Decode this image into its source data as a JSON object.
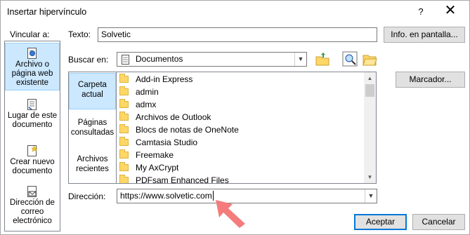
{
  "window": {
    "title": "Insertar hipervínculo",
    "help_glyph": "?",
    "close_glyph": "✕"
  },
  "link_to": {
    "label": "Vincular a:",
    "items": [
      {
        "label": "Archivo o página web existente",
        "icon": "web-page-icon",
        "selected": true
      },
      {
        "label": "Lugar de este documento",
        "icon": "document-place-icon",
        "selected": false
      },
      {
        "label": "Crear nuevo documento",
        "icon": "new-document-icon",
        "selected": false
      },
      {
        "label": "Dirección de correo electrónico",
        "icon": "email-icon",
        "selected": false
      }
    ]
  },
  "text_field": {
    "label": "Texto:",
    "value": "Solvetic"
  },
  "screentip_button": "Info. en pantalla...",
  "look_in": {
    "label": "Buscar en:",
    "value": "Documentos"
  },
  "bookmark_button": "Marcador...",
  "view_tabs": [
    {
      "label": "Carpeta actual",
      "selected": true
    },
    {
      "label": "Páginas consultadas",
      "selected": false
    },
    {
      "label": "Archivos recientes",
      "selected": false
    }
  ],
  "files": [
    "Add-in Express",
    "admin",
    "admx",
    "Archivos de Outlook",
    "Blocs de notas de OneNote",
    "Camtasia Studio",
    "Freemake",
    "My AxCrypt",
    "PDFsam Enhanced Files"
  ],
  "address": {
    "label": "Dirección:",
    "value": "https://www.solvetic.com"
  },
  "ok_button": "Aceptar",
  "cancel_button": "Cancelar",
  "colors": {
    "selection": "#cce8ff",
    "default_button_border": "#0078d7",
    "annotation_arrow": "#f47c7c"
  }
}
